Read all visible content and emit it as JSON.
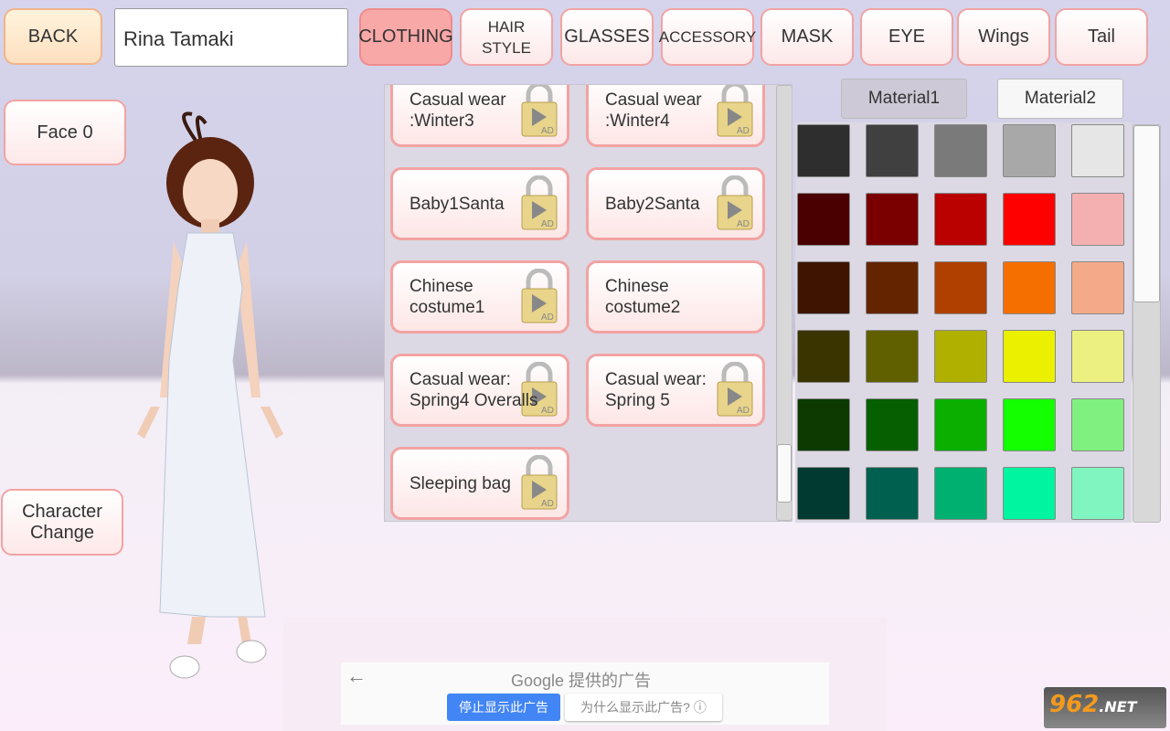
{
  "header": {
    "back_label": "BACK",
    "character_name": "Rina Tamaki",
    "tabs": [
      {
        "label": "CLOTHING",
        "active": true
      },
      {
        "label": "HAIR STYLE"
      },
      {
        "label": "GLASSES"
      },
      {
        "label": "ACCESSORY"
      },
      {
        "label": "MASK"
      },
      {
        "label": "EYE"
      },
      {
        "label": "Wings"
      },
      {
        "label": "Tail"
      }
    ]
  },
  "left": {
    "face_label": "Face 0",
    "character_change_label": "Character Change"
  },
  "clothing_list": {
    "items": [
      {
        "label": "Casual wear :Winter3",
        "locked": true
      },
      {
        "label": "Casual wear :Winter4",
        "locked": true
      },
      {
        "label": "Baby1Santa",
        "locked": true
      },
      {
        "label": "Baby2Santa",
        "locked": true
      },
      {
        "label": "Chinese costume1",
        "locked": true
      },
      {
        "label": "Chinese costume2",
        "locked": false
      },
      {
        "label": "Casual wear: Spring4 Overalls",
        "locked": true
      },
      {
        "label": "Casual wear: Spring 5",
        "locked": true
      },
      {
        "label": "Sleeping bag",
        "locked": true
      }
    ],
    "lock_badge": "AD",
    "scroll_position": 0.95
  },
  "materials": {
    "tabs": [
      "Material1",
      "Material2"
    ],
    "selected": "Material1"
  },
  "palette": {
    "scroll_position": 0,
    "colors": [
      [
        "#2e2e2e",
        "#404040",
        "#7a7a7a",
        "#a8a8a8",
        "#e6e6e6"
      ],
      [
        "#4a0000",
        "#7a0000",
        "#bb0000",
        "#ff0000",
        "#f4b0b0"
      ],
      [
        "#3f1400",
        "#652400",
        "#b04000",
        "#f56e00",
        "#f4aa88"
      ],
      [
        "#3a3500",
        "#606000",
        "#b0b000",
        "#eaf000",
        "#ecf080"
      ],
      [
        "#0c3a00",
        "#065f00",
        "#0aaf00",
        "#14ff00",
        "#80f080"
      ],
      [
        "#003a30",
        "#006050",
        "#00b070",
        "#00f5a0",
        "#80f5c0"
      ]
    ]
  },
  "ad": {
    "title": "Google 提供的广告",
    "stop_label": "停止显示此广告",
    "why_label": "为什么显示此广告?",
    "accent": "#4285f4"
  },
  "watermark": {
    "text": "962.NET 乐游网"
  }
}
